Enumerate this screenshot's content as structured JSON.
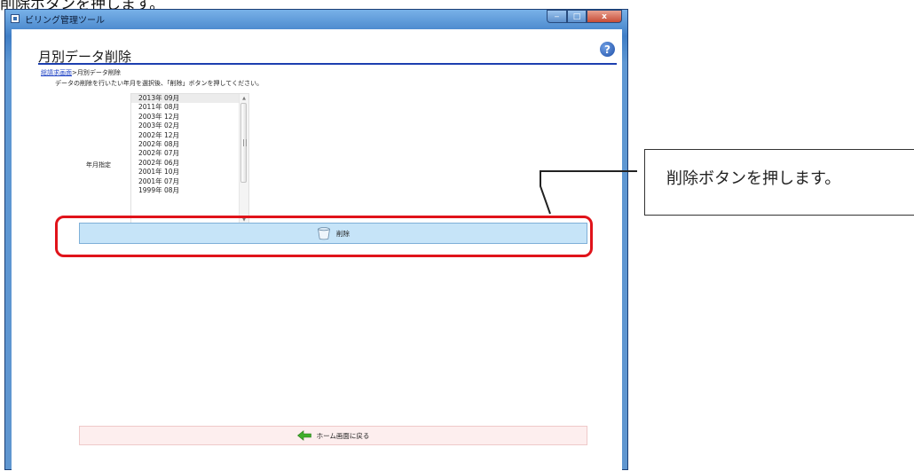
{
  "caption": "削除ボタンを押します。",
  "window": {
    "title": "ビリング管理ツール",
    "min": "‒",
    "max": "□",
    "close": "x"
  },
  "page": {
    "title": "月別データ削除",
    "help": "?",
    "breadcrumb_link": "総請求画面",
    "breadcrumb_rest": ">月別データ削除",
    "instructions": "データの削除を行いたい年月を選択後、「削除」ボタンを押してください。"
  },
  "year_month": {
    "label": "年月指定",
    "items": [
      "2013年 09月",
      "2011年 08月",
      "2003年 12月",
      "2003年 02月",
      "2002年 12月",
      "2002年 08月",
      "2002年 07月",
      "2002年 06月",
      "2001年 10月",
      "2001年 07月",
      "1999年 08月"
    ],
    "selected_index": 0
  },
  "delete_button": {
    "label": "削除",
    "icon": "trash-icon"
  },
  "home_button": {
    "label": "ホーム画面に戻る",
    "icon": "green-left-arrow-icon"
  },
  "colors": {
    "highlight": "#e0131a",
    "title_rule": "#1d3fb0",
    "delete_bg": "#c6e4f8",
    "home_bg": "#fdeeee"
  }
}
